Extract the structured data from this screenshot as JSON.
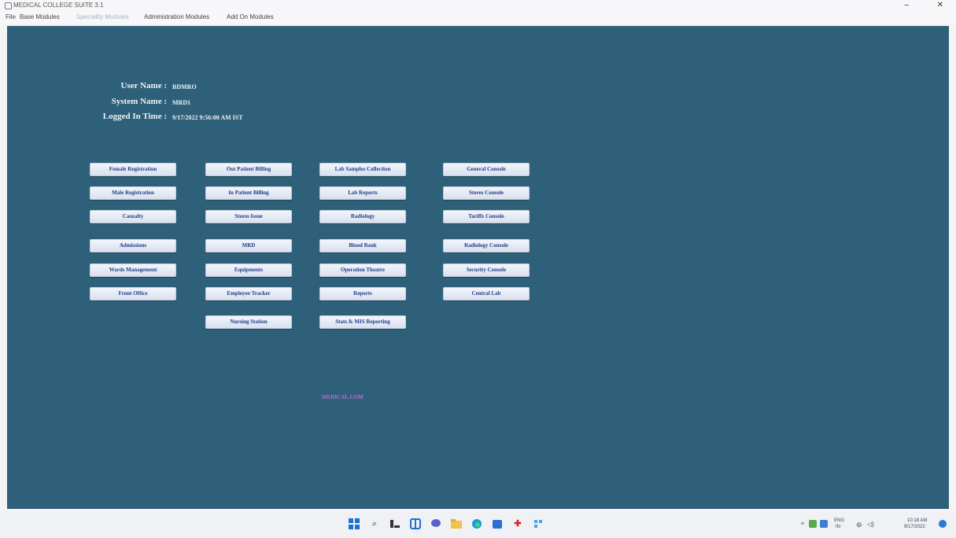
{
  "window": {
    "title": "MEDICAL COLLEGE SUITE 3.1",
    "minimize_glyph": "–",
    "close_glyph": "✕"
  },
  "menu": [
    "File",
    "Base Modules",
    "Speciality Modules",
    "Administration Modules",
    "Add On Modules"
  ],
  "session": {
    "user_label": "User Name :",
    "user_value": "BDMRO",
    "system_label": "System Name :",
    "system_value": "MRD1",
    "login_label": "Logged In Time :",
    "login_value": "9/17/2022 9:56:00 AM IST"
  },
  "modules": {
    "col1": [
      "Female Registration",
      "Male Registration",
      "Casualty",
      "Admissions",
      "Wards Management",
      "Front Office"
    ],
    "col2": [
      "Out Patient Billing",
      "In Patient Billing",
      "Stores Issue",
      "MRD",
      "Equipments",
      "Employee Tracker",
      "Nursing Station"
    ],
    "col3": [
      "Lab Samples Collection",
      "Lab Reports",
      "Radiology",
      "Blood Bank",
      "Operation Theatre",
      "Reports",
      "Stats & MIS Reporting"
    ],
    "col4": [
      "General Console",
      "Stores Console",
      "Tariffs Console",
      "Radiology Console",
      "Security Console",
      "Central Lab"
    ]
  },
  "branding": "MEDICAL.COM",
  "taskbar": {
    "icons": [
      "windows-start-icon",
      "search-icon",
      "task-view-icon",
      "widgets-icon",
      "chat-icon",
      "file-explorer-icon",
      "edge-browser-icon",
      "store-icon",
      "medical-app-icon",
      "app-icon"
    ],
    "tray": {
      "lang_top": "ENG",
      "lang_bottom": "IN",
      "time": "10:18 AM",
      "date": "9/17/2022"
    }
  },
  "colors": {
    "background": "#2e6079",
    "button_text": "#1f3f87",
    "brand_text": "#b86cd0"
  }
}
